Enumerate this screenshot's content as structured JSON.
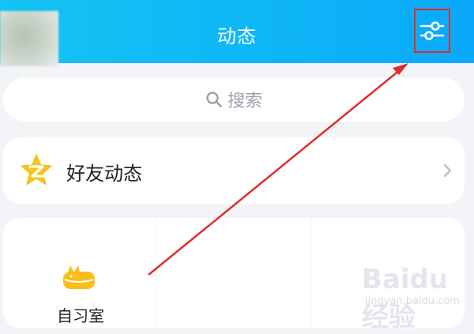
{
  "header": {
    "title": "动态",
    "background": "#10b9f5"
  },
  "search": {
    "placeholder": "搜索",
    "icon": "search-icon"
  },
  "friends": {
    "label": "好友动态",
    "icon": "qzone-star-icon",
    "chevron": "chevron-right-icon"
  },
  "apps": [
    {
      "label": "自习室",
      "icon": "cat-sofa-icon"
    },
    {
      "label": "",
      "icon": ""
    },
    {
      "label": "",
      "icon": ""
    }
  ],
  "annotation": {
    "color": "#e12b2b",
    "target": "filter-settings-button"
  },
  "watermark": {
    "text": "Baidu经验",
    "sub": "jingyan.baidu.com"
  }
}
